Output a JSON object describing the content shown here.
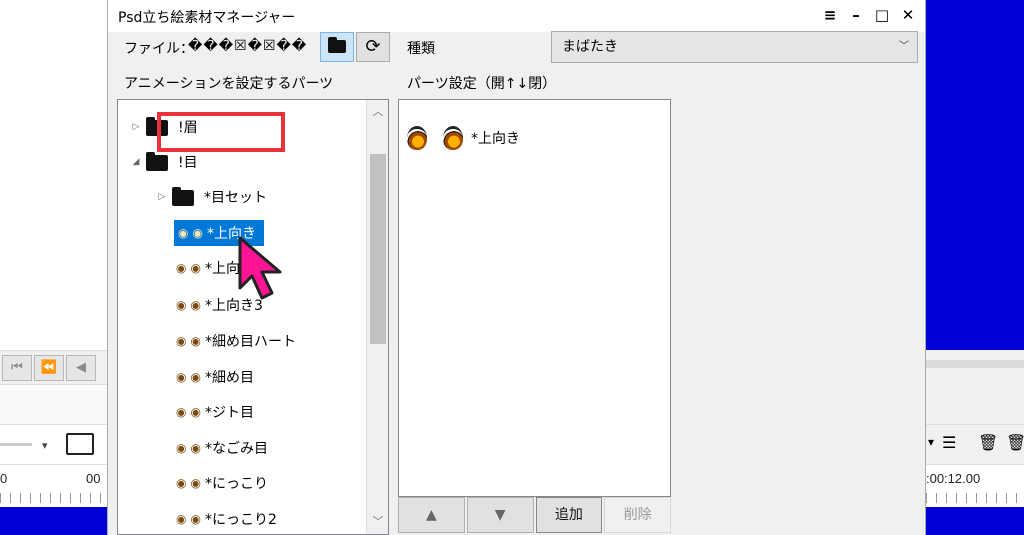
{
  "window": {
    "title": "Psd立ち絵素材マネージャー",
    "controls": [
      "≡",
      "–",
      "□",
      "✕"
    ]
  },
  "file": {
    "label": "ファイル：",
    "name": "���☒�☒��"
  },
  "buttons": {
    "folder": "■",
    "reload": "⟳"
  },
  "anim_parts_label": "アニメーションを設定するパーツ",
  "tree": {
    "nodes": [
      {
        "label": "!眉",
        "type": "folder",
        "expander": "▷"
      },
      {
        "label": "!目",
        "type": "folder",
        "expander": "◢"
      },
      {
        "label": "*目セット",
        "type": "folder",
        "expander": "▷"
      },
      {
        "label": "*上向き",
        "type": "item",
        "selected": true
      },
      {
        "label": "*上向",
        "type": "item"
      },
      {
        "label": "*上向き3",
        "type": "item"
      },
      {
        "label": "*細め目ハート",
        "type": "item"
      },
      {
        "label": "*細め目",
        "type": "item"
      },
      {
        "label": "*ジト目",
        "type": "item"
      },
      {
        "label": "*なごみ目",
        "type": "item"
      },
      {
        "label": "*にっこり",
        "type": "item"
      },
      {
        "label": "*にっこり2",
        "type": "item"
      }
    ],
    "thumb_icon": "◉"
  },
  "kind": {
    "label": "種類",
    "value": "まばたき"
  },
  "parts_setting_label": "パーツ設定（開↑↓閉）",
  "parts_list": [
    {
      "label": "*上向き"
    }
  ],
  "parts_buttons": {
    "up": "▲",
    "down": "▼",
    "add": "追加",
    "delete": "削除"
  },
  "background": {
    "ruler": {
      "left1": "0",
      "left2": "00",
      "right": ":00:12.00"
    },
    "transport": [
      "⏮",
      "⏪",
      "◀"
    ]
  },
  "colors": {
    "selection": "#0078d7",
    "highlight_box": "#e8323c",
    "cursor": "#ff1493",
    "bg_blue": "#0000d6"
  }
}
